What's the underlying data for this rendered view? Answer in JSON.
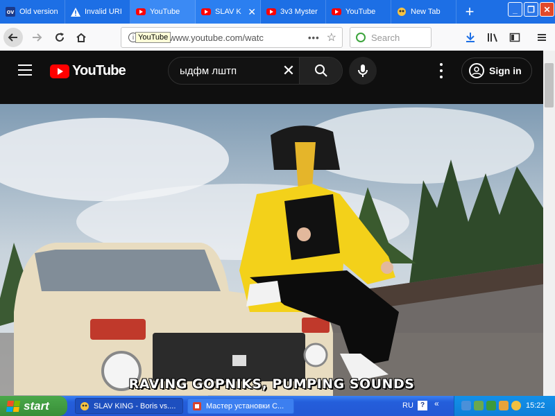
{
  "browser": {
    "tabs": [
      {
        "label": "Old version",
        "icon": "ov-icon"
      },
      {
        "label": "Invalid URI",
        "icon": "warning-icon"
      },
      {
        "label": "YouTube",
        "icon": "youtube-icon"
      },
      {
        "label": "SLAV K",
        "icon": "youtube-icon",
        "active": true
      },
      {
        "label": "3v3 Myster",
        "icon": "youtube-icon"
      },
      {
        "label": "YouTube",
        "icon": "youtube-icon"
      },
      {
        "label": "New Tab",
        "icon": "new-tab-icon"
      }
    ],
    "tooltip": "YouTube",
    "url_text": "https://www.youtube.com/watc",
    "search_placeholder": "Search"
  },
  "youtube": {
    "logo_text": "YouTube",
    "search_value": "ыдфм лштп",
    "sign_in_label": "Sign in",
    "video_caption": "RAVING GOPNIKS, PUMPING SOUNDS"
  },
  "taskbar": {
    "start_label": "start",
    "windows": [
      {
        "label": "SLAV KING - Boris vs...."
      },
      {
        "label": "Мастер установки С..."
      }
    ],
    "language": "RU",
    "clock": "15:22"
  }
}
